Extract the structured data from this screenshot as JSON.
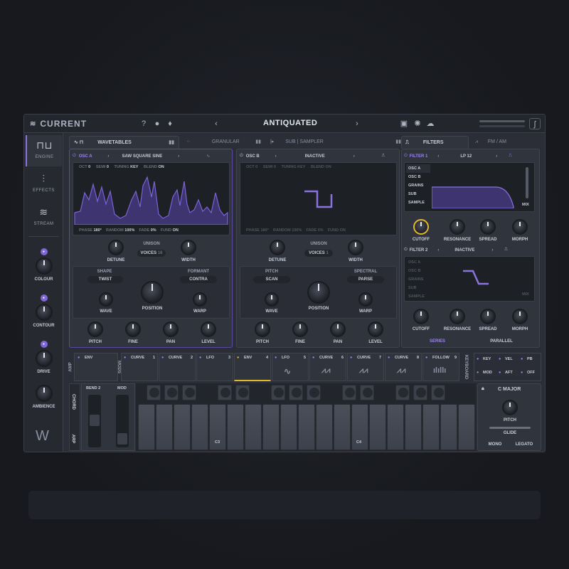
{
  "app": {
    "name": "CURRENT",
    "preset": "ANTIQUATED"
  },
  "nav": [
    {
      "label": "ENGINE"
    },
    {
      "label": "EFFECTS"
    },
    {
      "label": "STREAM"
    }
  ],
  "macros": [
    {
      "label": "COLOUR"
    },
    {
      "label": "CONTOUR"
    },
    {
      "label": "DRIVE"
    },
    {
      "label": "AMBIENCE"
    }
  ],
  "tabs": {
    "wavetables": "WAVETABLES",
    "granular": "GRANULAR",
    "sub_sampler": "SUB | SAMPLER",
    "filters": "FILTERS",
    "fm_am": "FM / AM"
  },
  "oscA": {
    "name": "OSC A",
    "wave": "SAW SQUARE SINE",
    "oct_l": "OCT",
    "oct": "0",
    "semi_l": "SEMI",
    "semi": "0",
    "tuning_l": "TUNING",
    "tuning": "KEY",
    "blend_l": "BLEND",
    "blend": "ON",
    "phase_l": "PHASE",
    "phase": "180°",
    "random_l": "RANDOM",
    "random": "100%",
    "fade_l": "FADE",
    "fade": "0%",
    "fund_l": "FUND",
    "fund": "ON",
    "detune": "DETUNE",
    "unison": "UNISON",
    "voices_l": "VOICES",
    "voices": "16",
    "width": "WIDTH",
    "shape_l": "SHAPE",
    "shape": "TWIST",
    "formant_l": "FORMANT",
    "formant": "CONTRA",
    "wave_k": "WAVE",
    "position": "POSITION",
    "warp": "WARP",
    "pitch": "PITCH",
    "fine": "FINE",
    "pan": "PAN",
    "level": "LEVEL"
  },
  "oscB": {
    "name": "OSC B",
    "state": "INACTIVE",
    "oct_l": "OCT",
    "oct": "0",
    "semi_l": "SEMI",
    "semi": "0",
    "tuning_l": "TUNING",
    "tuning": "KEY",
    "blend_l": "BLEND",
    "blend": "ON",
    "phase_l": "PHASE",
    "phase": "180°",
    "random_l": "RANDOM",
    "random": "100%",
    "fade_l": "FADE",
    "fade": "0%",
    "fund_l": "FUND",
    "fund": "ON",
    "detune": "DETUNE",
    "unison": "UNISON",
    "voices_l": "VOICES",
    "voices": "1",
    "width": "WIDTH",
    "pitch_l": "PITCH",
    "pitch_mode": "SCAN",
    "spectral_l": "SPECTRAL",
    "spectral": "PARSE",
    "wave_k": "WAVE",
    "position": "POSITION",
    "warp": "WARP",
    "pitch": "PITCH",
    "fine": "FINE",
    "pan": "PAN",
    "level": "LEVEL"
  },
  "filter1": {
    "name": "FILTER 1",
    "type": "LP 12",
    "sources": [
      "OSC A",
      "OSC B",
      "GRAINS",
      "SUB",
      "SAMPLE"
    ],
    "mix": "MIX",
    "cutoff": "CUTOFF",
    "resonance": "RESONANCE",
    "spread": "SPREAD",
    "morph": "MORPH"
  },
  "filter2": {
    "name": "FILTER 2",
    "state": "INACTIVE",
    "sources": [
      "OSC A",
      "OSC B",
      "GRAINS",
      "SUB",
      "SAMPLE"
    ],
    "mix": "MIX",
    "cutoff": "CUTOFF",
    "resonance": "RESONANCE",
    "spread": "SPREAD",
    "morph": "MORPH"
  },
  "routing": {
    "series": "SERIES",
    "parallel": "PARALLEL"
  },
  "mods": {
    "amp": "AMP",
    "mods": "MODS",
    "env": "ENV",
    "slots": [
      {
        "label": "CURVE",
        "num": "1"
      },
      {
        "label": "CURVE",
        "num": "2"
      },
      {
        "label": "LFO",
        "num": "3"
      },
      {
        "label": "ENV",
        "num": "4"
      },
      {
        "label": "LFO",
        "num": "5"
      },
      {
        "label": "CURVE",
        "num": "6"
      },
      {
        "label": "CURVE",
        "num": "7"
      },
      {
        "label": "CURVE",
        "num": "8"
      },
      {
        "label": "FOLLOW",
        "num": "9"
      }
    ],
    "keyboard": "KEYBOARD",
    "key": [
      "KEY",
      "VEL",
      "PB",
      "MOD",
      "AFT",
      "OFF"
    ]
  },
  "keys": {
    "bend_l": "BEND",
    "bend": "2",
    "mod": "MOD",
    "chord": "CHORD",
    "arp": "ARP",
    "c3": "C3",
    "c4": "C4",
    "scale": "C MAJOR",
    "pitch": "PITCH",
    "glide": "GLIDE",
    "mono": "MONO",
    "legato": "LEGATO"
  },
  "colors": {
    "accent": "#8a72e0",
    "wave": "#7b63d8",
    "panel": "#30343d"
  }
}
